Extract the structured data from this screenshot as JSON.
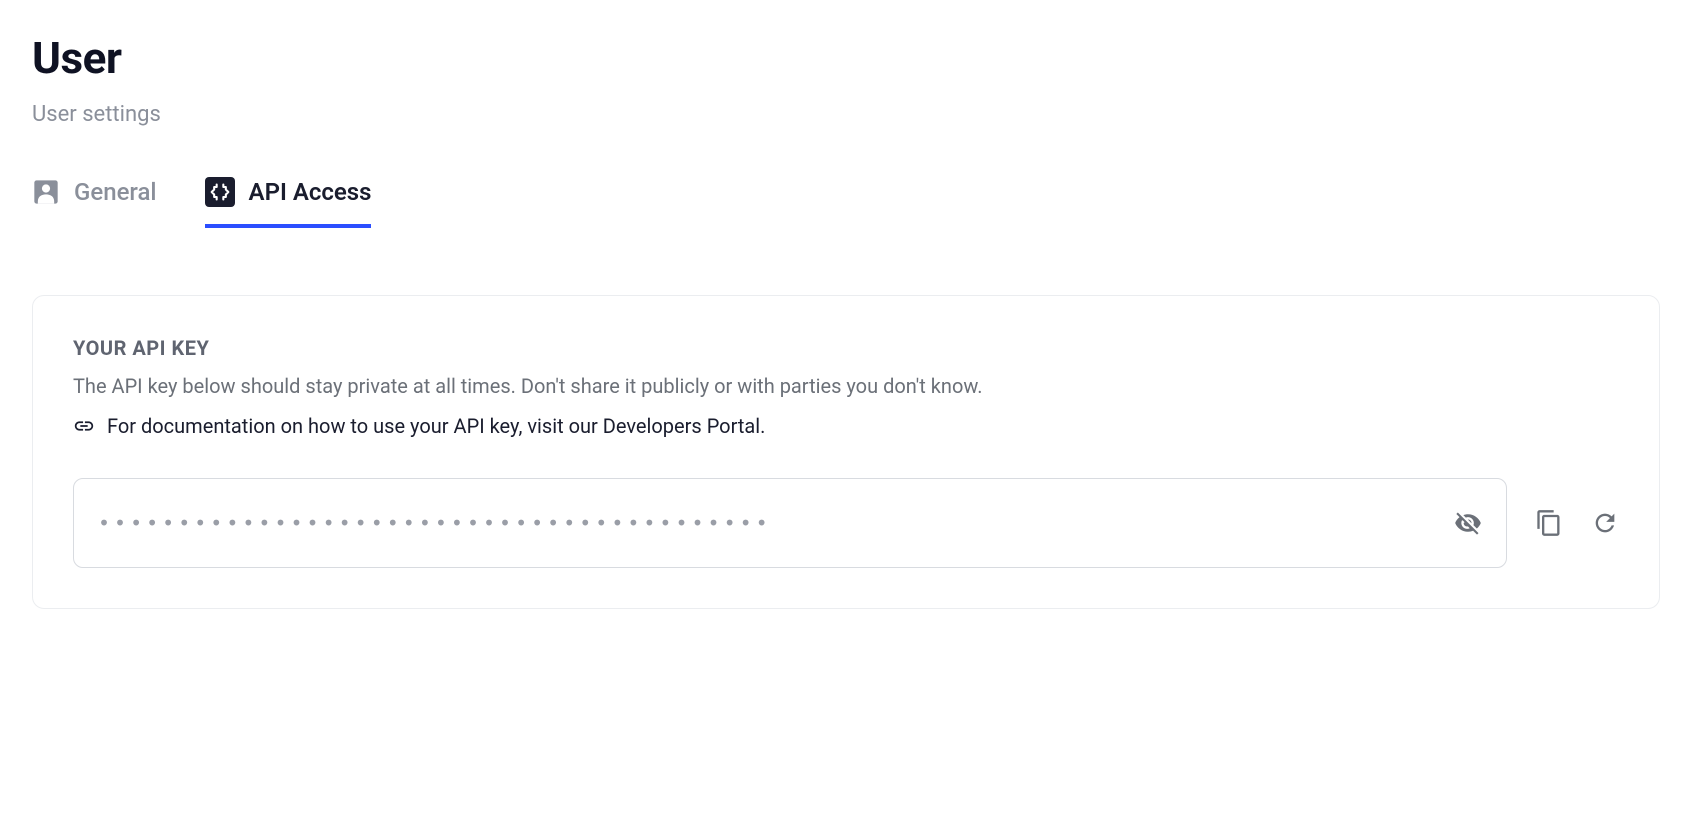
{
  "header": {
    "title": "User",
    "subtitle": "User settings"
  },
  "tabs": {
    "general": "General",
    "api_access": "API Access"
  },
  "api_section": {
    "title": "YOUR API KEY",
    "description": "The API key below should stay private at all times. Don't share it publicly or with parties you don't know.",
    "link_text": "For documentation on how to use your API key, visit our Developers Portal.",
    "key_value": "••••••••••••••••••••••••••••••••••••••••••"
  }
}
